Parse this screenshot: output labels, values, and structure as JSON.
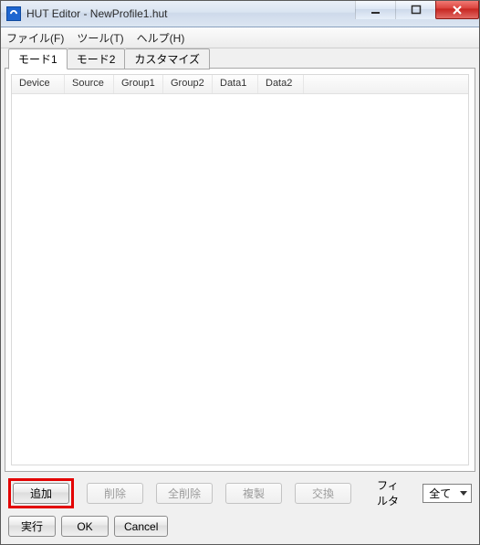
{
  "window": {
    "title": "HUT Editor - NewProfile1.hut"
  },
  "menu": {
    "file": "ファイル(F)",
    "tool": "ツール(T)",
    "help": "ヘルプ(H)"
  },
  "tabs": {
    "mode1": "モード1",
    "mode2": "モード2",
    "customize": "カスタマイズ",
    "active": "mode1"
  },
  "columns": {
    "device": "Device",
    "source": "Source",
    "group1": "Group1",
    "group2": "Group2",
    "data1": "Data1",
    "data2": "Data2"
  },
  "buttons": {
    "add": "追加",
    "delete": "削除",
    "deleteAll": "全削除",
    "duplicate": "複製",
    "swap": "交換",
    "run": "実行",
    "ok": "OK",
    "cancel": "Cancel"
  },
  "filter": {
    "label": "フィルタ",
    "selected": "全て"
  }
}
